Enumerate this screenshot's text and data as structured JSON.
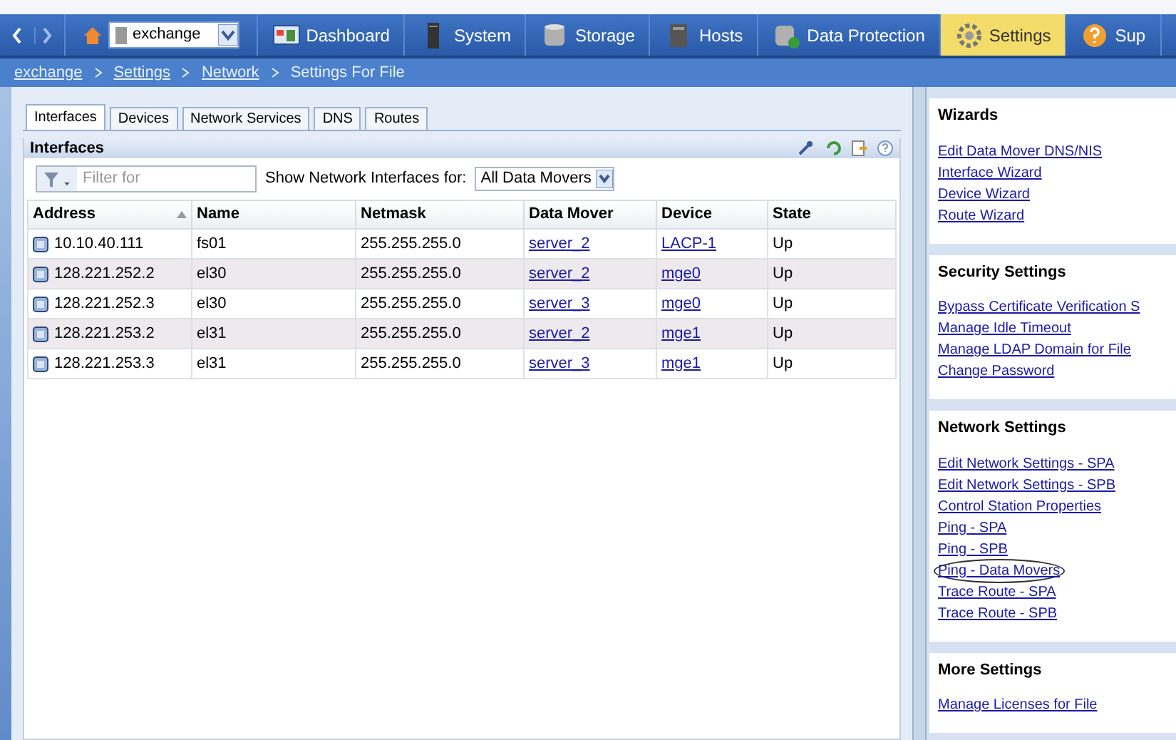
{
  "nav": {
    "location": "exchange",
    "items": [
      {
        "label": "Dashboard",
        "kind": "dashboard",
        "selected": false
      },
      {
        "label": "System",
        "kind": "system",
        "selected": false
      },
      {
        "label": "Storage",
        "kind": "storage",
        "selected": false
      },
      {
        "label": "Hosts",
        "kind": "hosts",
        "selected": false
      },
      {
        "label": "Data Protection",
        "kind": "protection",
        "selected": false
      },
      {
        "label": "Settings",
        "kind": "settings",
        "selected": true
      },
      {
        "label": "Sup",
        "kind": "support",
        "selected": false
      }
    ]
  },
  "breadcrumb": {
    "links": [
      "exchange",
      "Settings",
      "Network"
    ],
    "current": "Settings For File"
  },
  "tabs": [
    {
      "label": "Interfaces",
      "selected": true
    },
    {
      "label": "Devices",
      "selected": false
    },
    {
      "label": "Network Services",
      "selected": false
    },
    {
      "label": "DNS",
      "selected": false
    },
    {
      "label": "Routes",
      "selected": false
    }
  ],
  "panel": {
    "title": "Interfaces",
    "filter": {
      "placeholder": "Filter for"
    },
    "show_label": "Show Network Interfaces for:",
    "show_value": "All Data Movers"
  },
  "table": {
    "columns": [
      {
        "label": "Address",
        "sorted": true
      },
      {
        "label": "Name",
        "sorted": false
      },
      {
        "label": "Netmask",
        "sorted": false
      },
      {
        "label": "Data Mover",
        "sorted": false
      },
      {
        "label": "Device",
        "sorted": false
      },
      {
        "label": "State",
        "sorted": false
      }
    ],
    "rows": [
      [
        "10.10.40.111",
        "fs01",
        "255.255.255.0",
        "server_2",
        "LACP-1",
        "Up"
      ],
      [
        "128.221.252.2",
        "el30",
        "255.255.255.0",
        "server_2",
        "mge0",
        "Up"
      ],
      [
        "128.221.252.3",
        "el30",
        "255.255.255.0",
        "server_3",
        "mge0",
        "Up"
      ],
      [
        "128.221.253.2",
        "el31",
        "255.255.255.0",
        "server_2",
        "mge1",
        "Up"
      ],
      [
        "128.221.253.3",
        "el31",
        "255.255.255.0",
        "server_3",
        "mge1",
        "Up"
      ]
    ]
  },
  "sidebar": [
    {
      "title": "Wizards",
      "links": [
        {
          "label": "Edit Data Mover DNS/NIS",
          "circled": false
        },
        {
          "label": "Interface Wizard",
          "circled": false
        },
        {
          "label": "Device Wizard",
          "circled": false
        },
        {
          "label": "Route Wizard",
          "circled": false
        }
      ]
    },
    {
      "title": "Security Settings",
      "links": [
        {
          "label": "Bypass Certificate Verification S",
          "circled": false
        },
        {
          "label": "Manage Idle Timeout",
          "circled": false
        },
        {
          "label": "Manage LDAP Domain for File",
          "circled": false
        },
        {
          "label": "Change Password",
          "circled": false
        }
      ]
    },
    {
      "title": "Network Settings",
      "links": [
        {
          "label": "Edit Network Settings - SPA",
          "circled": false
        },
        {
          "label": "Edit Network Settings - SPB",
          "circled": false
        },
        {
          "label": "Control Station Properties",
          "circled": false
        },
        {
          "label": "Ping - SPA",
          "circled": false
        },
        {
          "label": "Ping - SPB",
          "circled": false
        },
        {
          "label": "Ping - Data Movers",
          "circled": true
        },
        {
          "label": "Trace Route - SPA",
          "circled": false
        },
        {
          "label": "Trace Route - SPB",
          "circled": false
        }
      ]
    },
    {
      "title": "More Settings",
      "links": [
        {
          "label": "Manage Licenses for File",
          "circled": false
        }
      ]
    }
  ]
}
